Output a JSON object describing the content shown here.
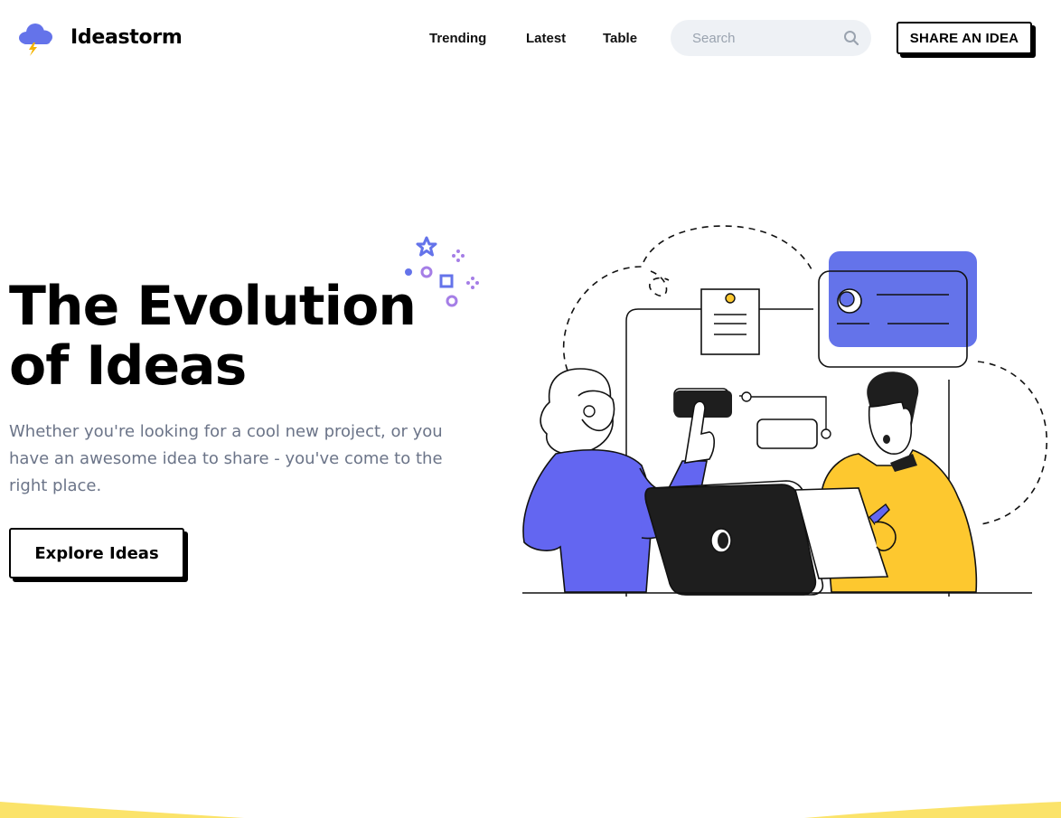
{
  "header": {
    "brand": "Ideastorm",
    "logo_icon": "cloud-lightning-icon",
    "nav": [
      {
        "label": "Trending"
      },
      {
        "label": "Latest"
      },
      {
        "label": "Table"
      }
    ],
    "search": {
      "placeholder": "Search",
      "value": "",
      "icon": "search-icon"
    },
    "cta_label": "SHARE AN IDEA"
  },
  "hero": {
    "title_line1": "The Evolution",
    "title_line2": "of Ideas",
    "subtitle": "Whether you're looking for a cool new project, or you have an awesome idea to share - you've come to the right place.",
    "button_label": "Explore Ideas"
  },
  "colors": {
    "accent_blue": "#6473ea",
    "accent_purple": "#6366f1",
    "accent_yellow": "#fdc82f",
    "sparkle_purple": "#a57ee6",
    "text_muted": "#6b7488",
    "search_bg": "#eef1f5",
    "footer_wave": "#fbe36a"
  }
}
